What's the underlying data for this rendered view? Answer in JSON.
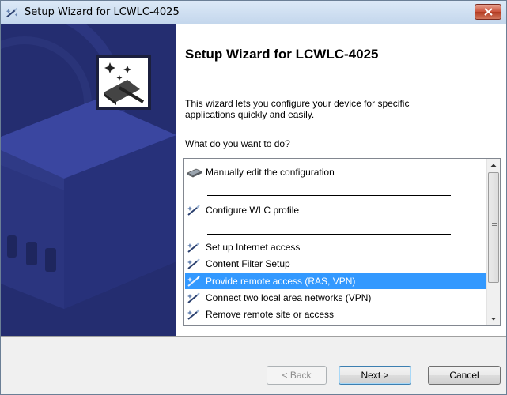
{
  "window": {
    "title": "Setup Wizard for LCWLC-4025",
    "icons": {
      "app": "wizard-wand-icon",
      "close": "close-icon"
    }
  },
  "header": {
    "heading": "Setup Wizard for LCWLC-4025",
    "description": "This wizard lets you configure your device for specific applications quickly and easily.",
    "question": "What do you want to do?"
  },
  "options": {
    "items": [
      {
        "label": "Manually edit the configuration",
        "icon": "device-icon"
      },
      {
        "label": "Configure WLC profile",
        "icon": "wizard-wand-icon"
      },
      {
        "label": "Set up Internet access",
        "icon": "wizard-wand-icon"
      },
      {
        "label": "Content Filter Setup",
        "icon": "wizard-wand-icon"
      },
      {
        "label": "Provide remote access (RAS, VPN)",
        "icon": "wizard-wand-icon",
        "selected": true
      },
      {
        "label": "Connect two local area networks (VPN)",
        "icon": "wizard-wand-icon"
      },
      {
        "label": "Remove remote site or access",
        "icon": "wizard-wand-icon"
      }
    ]
  },
  "buttons": {
    "back": "< Back",
    "next": "Next >",
    "cancel": "Cancel"
  },
  "colors": {
    "selection": "#3399ff",
    "side_panel": "#232c6e"
  }
}
